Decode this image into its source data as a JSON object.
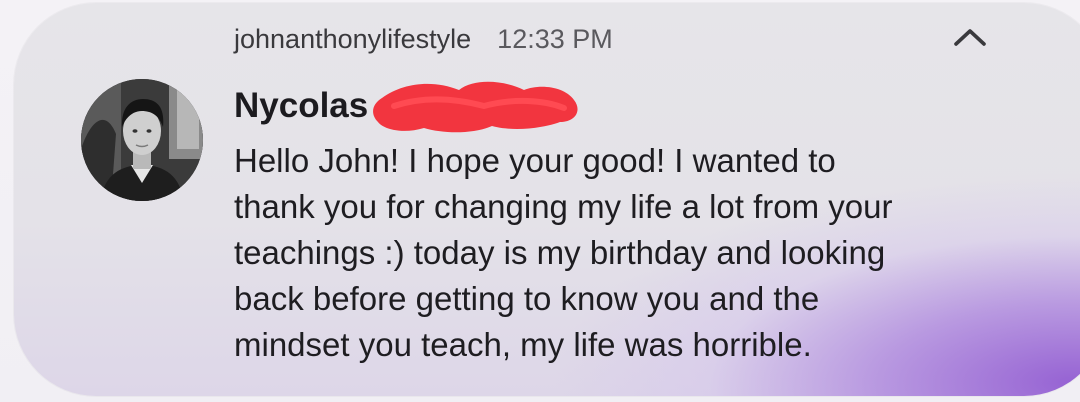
{
  "notification": {
    "app_name": "johnanthonylifestyle",
    "time": "12:33 PM",
    "expand_icon": "chevron-up-icon",
    "sender_name": "Nycolas",
    "sender_redacted": true,
    "avatar": "profile-photo-avatar",
    "message_lines": [
      "Hello John! I hope your good! I wanted to",
      "thank you for changing my life a lot from your",
      "teachings :) today is my birthday and looking",
      "back before getting to know you and the",
      "mindset you teach, my life was horrible."
    ]
  },
  "colors": {
    "card_background": "#e5e4e8",
    "accent_gradient": "#925cd2",
    "redaction": "#f2353f",
    "text_primary": "#1e1d21",
    "text_secondary": "#3a393d"
  }
}
